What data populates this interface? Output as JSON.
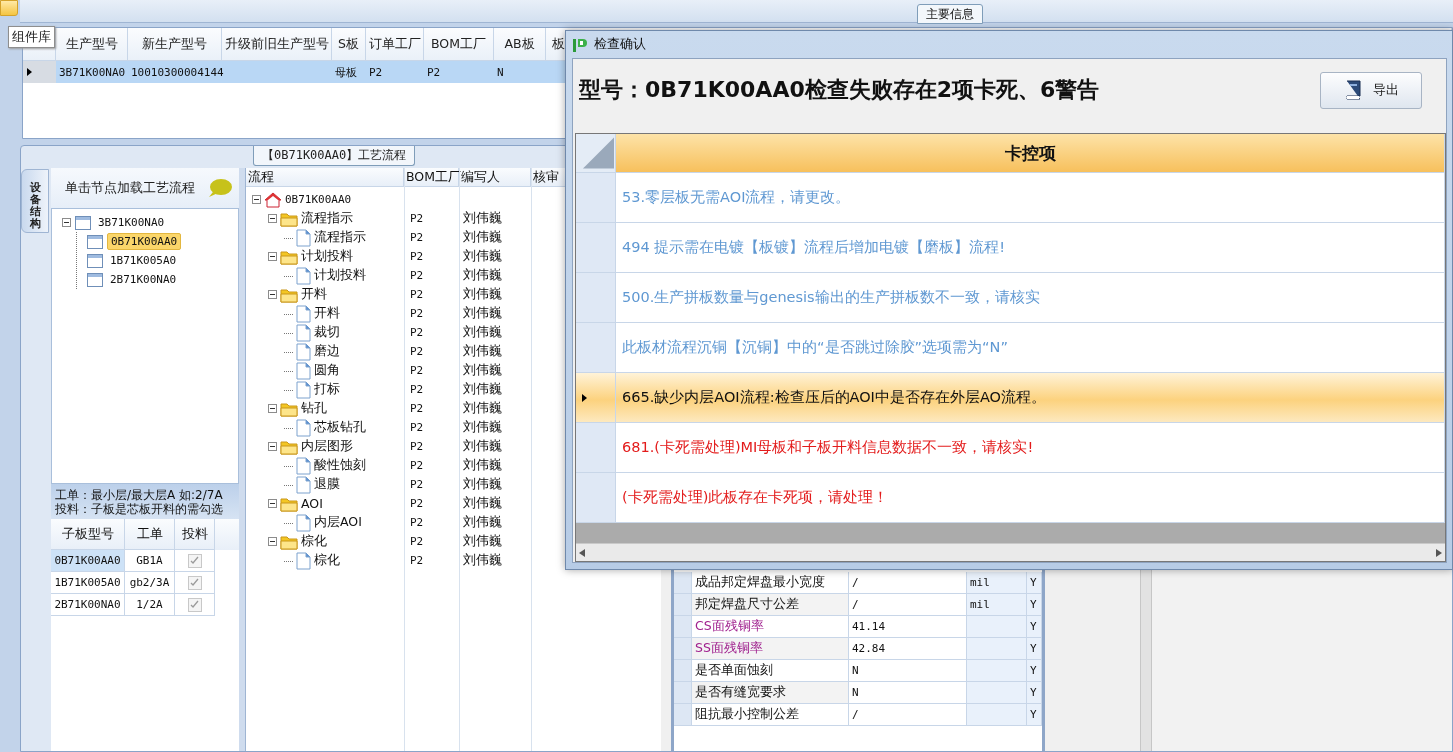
{
  "top_tab": {
    "label": "主要信息"
  },
  "tooltip": {
    "text": "组件库"
  },
  "main_grid": {
    "columns": [
      "生产型号",
      "新生产型号",
      "升级前旧生产型号",
      "S板",
      "订单工厂",
      "BOM工厂",
      "AB板",
      "板"
    ],
    "rows": [
      {
        "selected": true,
        "cells": [
          "3B71K00NA0",
          "10010300004144",
          null,
          "母板",
          "P2",
          "P2",
          "N",
          null
        ]
      }
    ]
  },
  "process_panel": {
    "title": "【0B71K00AA0】工艺流程"
  },
  "side_tab": {
    "label": "设备结构"
  },
  "structure": {
    "hint": "单击节点加载工艺流程",
    "tree": [
      {
        "label": "3B71K00NA0",
        "expanded": true,
        "selected": false,
        "children": [
          {
            "label": "0B71K00AA0",
            "selected": true
          },
          {
            "label": "1B71K005A0",
            "selected": false
          },
          {
            "label": "2B71K00NA0",
            "selected": false
          }
        ]
      }
    ],
    "notes": [
      "工单：最小层/最大层A 如:2/7A",
      "投料：子板是芯板开料的需勾选"
    ],
    "subboards": {
      "columns": [
        "子板型号",
        "工单",
        "投料"
      ],
      "rows": [
        {
          "model": "0B71K00AA0",
          "work_order": "GB1A",
          "fed": true,
          "selected": true
        },
        {
          "model": "1B71K005A0",
          "work_order": "gb2/3A",
          "fed": true,
          "selected": false
        },
        {
          "model": "2B71K00NA0",
          "work_order": "1/2A",
          "fed": true,
          "selected": false
        }
      ]
    }
  },
  "flow": {
    "columns": [
      "流程",
      "BOM工厂",
      "编写人",
      "核审"
    ],
    "tree": [
      {
        "label": "0B71K00AA0",
        "kind": "root",
        "expanded": true,
        "children": [
          {
            "label": "流程指示",
            "kind": "folder",
            "bom": "P2",
            "writer": "刘伟巍",
            "expanded": true,
            "children": [
              {
                "label": "流程指示",
                "kind": "step",
                "bom": "P2",
                "writer": "刘伟巍"
              }
            ]
          },
          {
            "label": "计划投料",
            "kind": "folder",
            "bom": "P2",
            "writer": "刘伟巍",
            "expanded": true,
            "children": [
              {
                "label": "计划投料",
                "kind": "step",
                "bom": "P2",
                "writer": "刘伟巍"
              }
            ]
          },
          {
            "label": "开料",
            "kind": "folder",
            "bom": "P2",
            "writer": "刘伟巍",
            "expanded": true,
            "children": [
              {
                "label": "开料",
                "kind": "step",
                "bom": "P2",
                "writer": "刘伟巍"
              },
              {
                "label": "裁切",
                "kind": "step",
                "bom": "P2",
                "writer": "刘伟巍"
              },
              {
                "label": "磨边",
                "kind": "step",
                "bom": "P2",
                "writer": "刘伟巍"
              },
              {
                "label": "圆角",
                "kind": "step",
                "bom": "P2",
                "writer": "刘伟巍"
              },
              {
                "label": "打标",
                "kind": "step",
                "bom": "P2",
                "writer": "刘伟巍"
              }
            ]
          },
          {
            "label": "钻孔",
            "kind": "folder",
            "bom": "P2",
            "writer": "刘伟巍",
            "expanded": true,
            "children": [
              {
                "label": "芯板钻孔",
                "kind": "step",
                "bom": "P2",
                "writer": "刘伟巍"
              }
            ]
          },
          {
            "label": "内层图形",
            "kind": "folder",
            "bom": "P2",
            "writer": "刘伟巍",
            "expanded": true,
            "children": [
              {
                "label": "酸性蚀刻",
                "kind": "step",
                "bom": "P2",
                "writer": "刘伟巍"
              },
              {
                "label": "退膜",
                "kind": "step",
                "bom": "P2",
                "writer": "刘伟巍"
              }
            ]
          },
          {
            "label": "AOI",
            "kind": "folder",
            "bom": "P2",
            "writer": "刘伟巍",
            "expanded": true,
            "children": [
              {
                "label": "内层AOI",
                "kind": "step",
                "bom": "P2",
                "writer": "刘伟巍"
              }
            ]
          },
          {
            "label": "棕化",
            "kind": "folder",
            "bom": "P2",
            "writer": "刘伟巍",
            "expanded": true,
            "children": [
              {
                "label": "棕化",
                "kind": "step",
                "bom": "P2",
                "writer": "刘伟巍"
              }
            ]
          }
        ]
      }
    ]
  },
  "parameters": {
    "rows": [
      {
        "name": "成品邦定焊盘最小宽度",
        "value": "/",
        "unit": "mil",
        "flag": "Y",
        "highlighted": false
      },
      {
        "name": "邦定焊盘尺寸公差",
        "value": "/",
        "unit": "mil",
        "flag": "Y",
        "highlighted": false
      },
      {
        "name": "CS面残铜率",
        "value": "41.14",
        "flag": "Y",
        "highlighted": true
      },
      {
        "name": "SS面残铜率",
        "value": "42.84",
        "flag": "Y",
        "highlighted": true
      },
      {
        "name": "是否单面蚀刻",
        "value": "N",
        "flag": "Y",
        "highlighted": false
      },
      {
        "name": "是否有缝宽要求",
        "value": "N",
        "flag": "Y",
        "highlighted": false
      },
      {
        "name": "阻抗最小控制公差",
        "value": "/",
        "flag": "Y",
        "highlighted": false
      }
    ]
  },
  "dialog": {
    "title": "检查确认",
    "heading": "型号：0B71K00AA0检查失败存在2项卡死、6警告",
    "export_button": "导出",
    "column": "卡控项",
    "items": [
      {
        "text": "53.零层板无需AOI流程，请更改。",
        "kind": "warning",
        "selected": false
      },
      {
        "text": "494 提示需在电镀【板镀】流程后增加电镀【磨板】流程!",
        "kind": "warning",
        "selected": false
      },
      {
        "text": "500.生产拼板数量与genesis输出的生产拼板数不一致，请核实",
        "kind": "warning",
        "selected": false
      },
      {
        "text": "此板材流程沉铜【沉铜】中的“是否跳过除胶”选项需为“N”",
        "kind": "warning",
        "selected": false
      },
      {
        "text": "665.缺少内层AOI流程:检查压后的AOI中是否存在外层AO流程。",
        "kind": "warning",
        "selected": true
      },
      {
        "text": "681.(卡死需处理)MI母板和子板开料信息数据不一致，请核实!",
        "kind": "blocking",
        "selected": false
      },
      {
        "text": "(卡死需处理)此板存在卡死项，请处理！",
        "kind": "blocking",
        "selected": false
      }
    ]
  }
}
